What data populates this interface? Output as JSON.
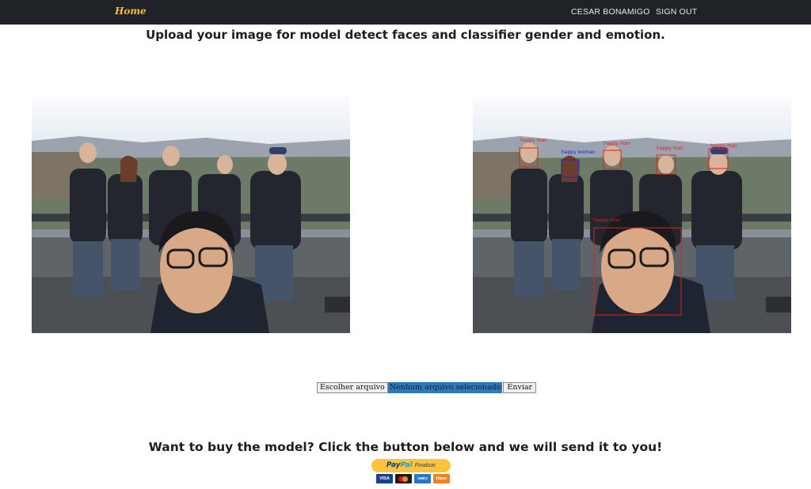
{
  "nav": {
    "brand": "Home",
    "user": "CESAR BONAMIGO",
    "signout": "SIGN OUT"
  },
  "upload": {
    "heading": "Upload your image for model detect faces and classifier gender and emotion.",
    "choose_file": "Escolher arquivo",
    "file_status": "Nenhum arquivo selecionado",
    "submit": "Enviar"
  },
  "detections": [
    {
      "label": "happy man",
      "color": "#e02020"
    },
    {
      "label": "happy woman",
      "color": "#2020d0"
    },
    {
      "label": "happy man",
      "color": "#e02020"
    },
    {
      "label": "happy man",
      "color": "#e02020"
    },
    {
      "label": "happy man",
      "color": "#e02020"
    },
    {
      "label": "happy man",
      "color": "#e02020"
    }
  ],
  "buy": {
    "heading": "Want to buy the model? Click the button below and we will send it to you!",
    "paypal_brand_1": "Pay",
    "paypal_brand_2": "Pal",
    "paypal_action": "Finalizar",
    "cards": [
      "VISA",
      "AMEX",
      "Hiper"
    ]
  },
  "colors": {
    "navbar": "#1f2227",
    "brand": "#f2c12e",
    "paypal": "#ffc439",
    "male_box": "#e02020",
    "female_box": "#2020d0"
  }
}
